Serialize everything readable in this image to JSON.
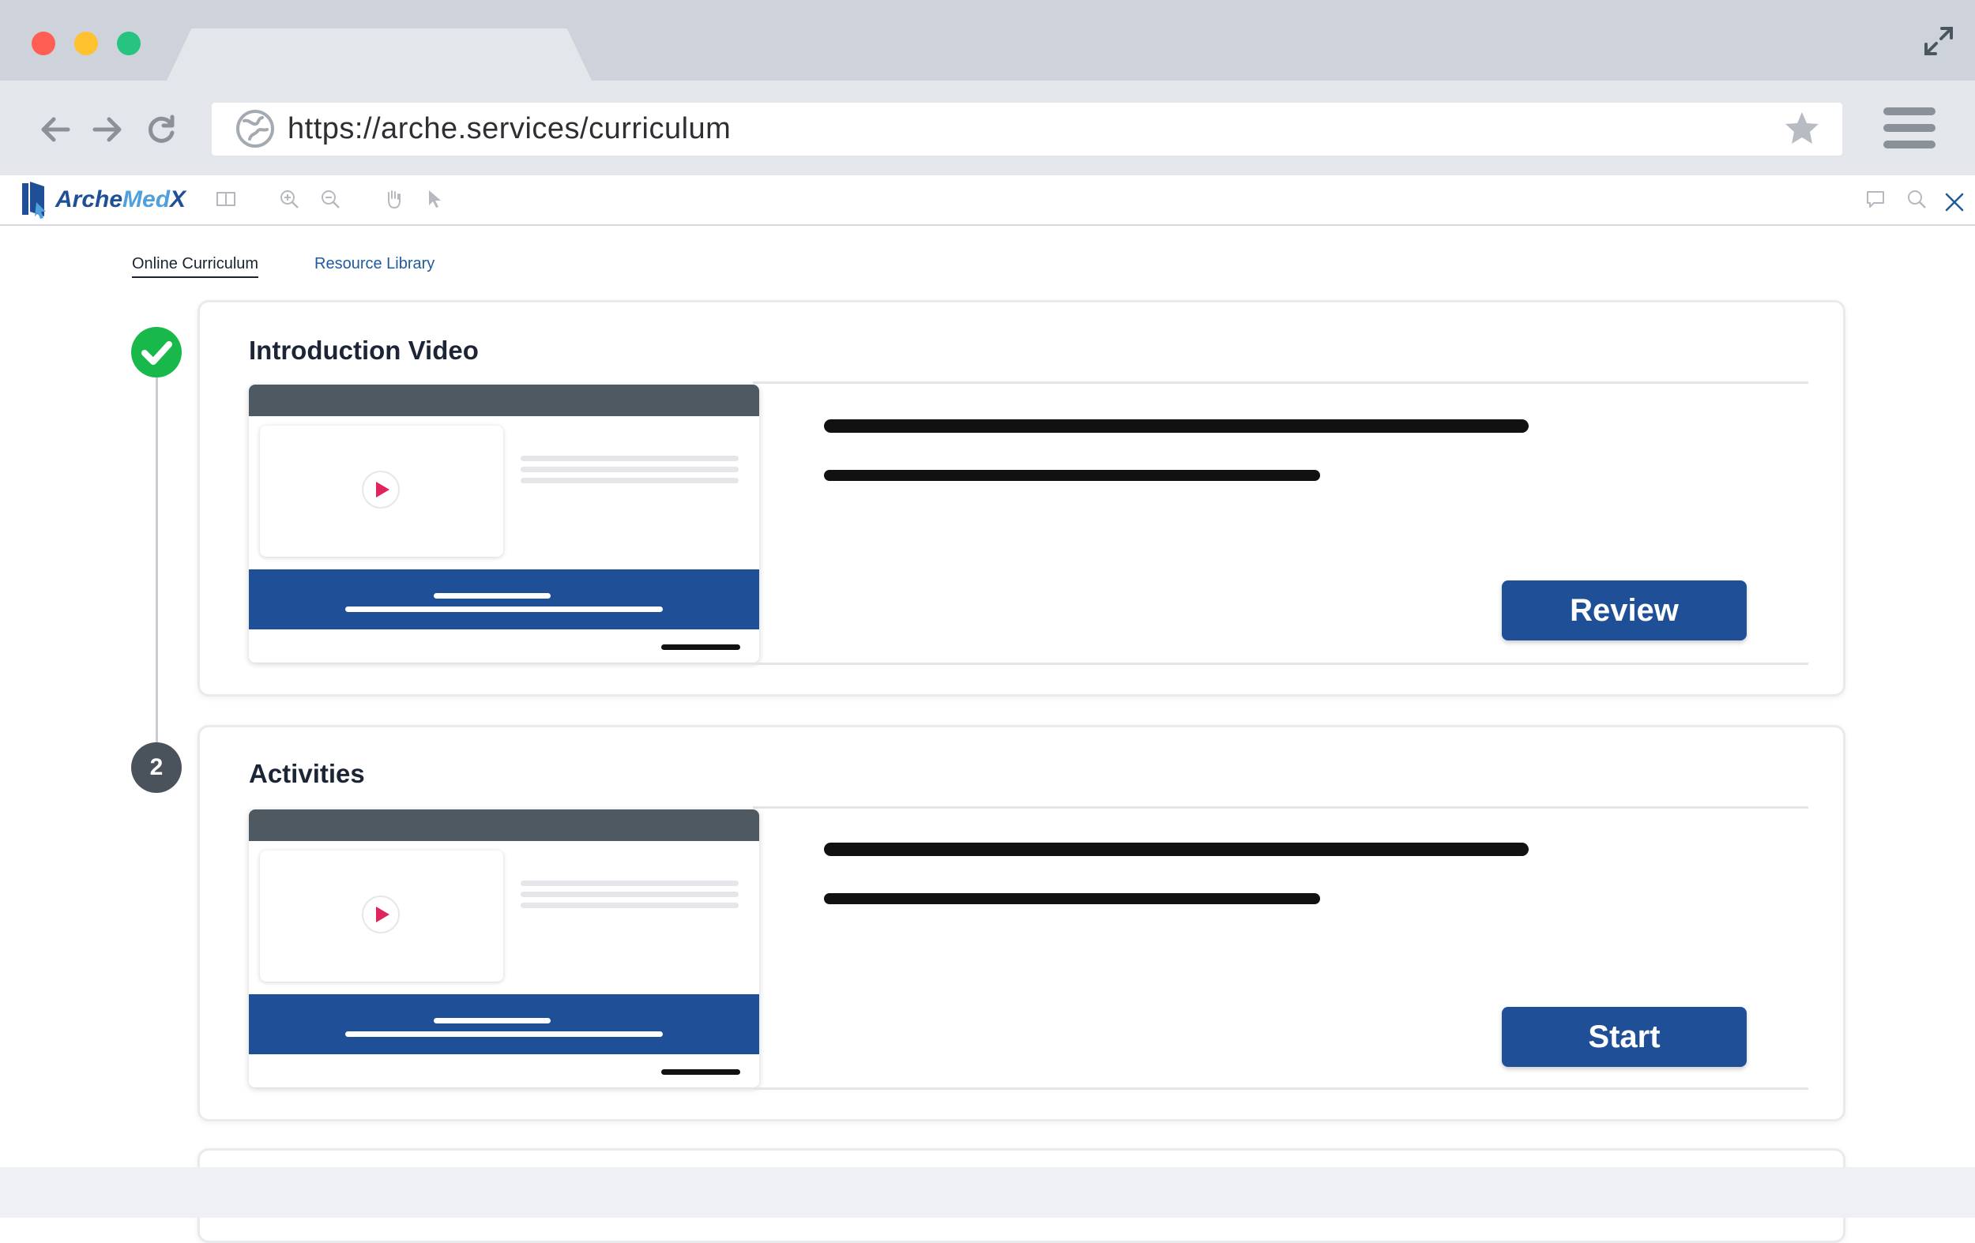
{
  "browser": {
    "url": "https://arche.services/curriculum",
    "colors": {
      "close": "#ff5f52",
      "minimize": "#ffc22e",
      "maximize": "#27c381"
    },
    "icons": [
      "back-arrow-icon",
      "forward-arrow-icon",
      "reload-icon",
      "globe-icon",
      "star-icon",
      "hamburger-menu-icon",
      "expand-icon"
    ]
  },
  "app": {
    "logo_prefix": "Arche",
    "logo_accent": "Med",
    "logo_suffix": "X",
    "toolbar_icons": [
      "sidebar-toggle-icon",
      "zoom-in-icon",
      "zoom-out-icon",
      "hand-tool-icon",
      "pointer-icon"
    ],
    "right_icons": [
      "comment-icon",
      "search-icon",
      "close-icon"
    ]
  },
  "nav": {
    "tabs": [
      {
        "label": "Online Curriculum",
        "active": true
      },
      {
        "label": "Resource Library",
        "active": false
      }
    ]
  },
  "steps": [
    {
      "status": "completed",
      "number": "1",
      "title": "Introduction Video",
      "button_label": "Review"
    },
    {
      "status": "current",
      "number": "2",
      "title": "Activities",
      "button_label": "Start"
    }
  ],
  "colors": {
    "brand_blue": "#1f4f96",
    "complete_green": "#19b84b",
    "play_red": "#e0245e"
  }
}
